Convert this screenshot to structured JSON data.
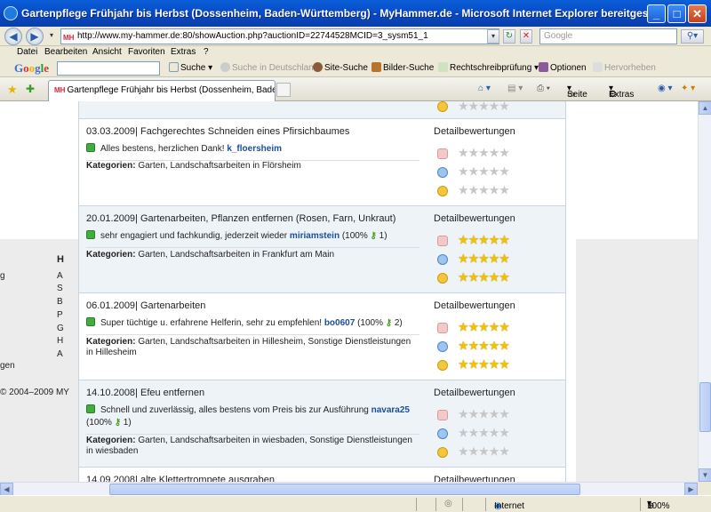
{
  "window": {
    "title": "Gartenpflege Frühjahr bis Herbst (Dossenheim, Baden-Württemberg) - MyHammer.de - Microsoft Internet Explorer bereitgestellt von",
    "buttons": {
      "minimize": "_",
      "maximize": "□",
      "close": "✕"
    }
  },
  "address": {
    "url": "http://www.my-hammer.de:80/showAuction.php?auctionID=22744528MCID=3_sysm51_1",
    "favicon_text": "MH",
    "search_placeholder": "Google"
  },
  "menu": [
    "Datei",
    "Bearbeiten",
    "Ansicht",
    "Favoriten",
    "Extras",
    "?"
  ],
  "google_toolbar": {
    "logo": "Google",
    "search_label": "Suche",
    "search_de_label": "Suche in Deutschland",
    "site_search_label": "Site-Suche",
    "image_search_label": "Bilder-Suche",
    "spellcheck_label": "Rechtschreibprüfung",
    "options_label": "Optionen",
    "highlight_label": "Hervorheben"
  },
  "tabs": {
    "active_title": "Gartenpflege Frühjahr bis Herbst (Dossenheim, Baden...",
    "favicon_text": "MH",
    "page_label": "Seite",
    "tools_label": "Extras"
  },
  "page": {
    "footer_heading": "H",
    "footer_letters": [
      "A",
      "S",
      "B",
      "P",
      "G",
      "H",
      "A"
    ],
    "footer_left_frags": [
      "g",
      "gen"
    ],
    "copyright": "© 2004–2009 MY"
  },
  "reviews": {
    "detail_label": "Detailbewertungen",
    "category_label": "Kategorien:",
    "items": [
      {
        "date": "03.03.2009",
        "task": "Fachgerechtes Schneiden eines Pfirsichbaumes",
        "comment": "Alles bestens, herzlichen Dank!",
        "user": "k_floersheim",
        "score_text": "",
        "score_count": "",
        "categories": "Garten, Landschaftsarbeiten in Flörsheim",
        "ratings": [
          0,
          0,
          0
        ]
      },
      {
        "date": "20.01.2009",
        "task": "Gartenarbeiten, Pflanzen entfernen (Rosen, Farn, Unkraut)",
        "comment": "sehr engagiert und fachkundig, jederzeit wieder",
        "user": "miriamstein",
        "score_text": "(100%",
        "score_count": "1)",
        "categories": "Garten, Landschaftsarbeiten in Frankfurt am Main",
        "ratings": [
          5,
          5,
          5
        ]
      },
      {
        "date": "06.01.2009",
        "task": "Gartenarbeiten",
        "comment": "Super tüchtige u. erfahrene Helferin, sehr zu empfehlen!",
        "user": "bo0607",
        "score_text": "(100%",
        "score_count": "2)",
        "categories": "Garten, Landschaftsarbeiten in Hillesheim, Sonstige Dienstleistungen in Hillesheim",
        "ratings": [
          5,
          5,
          5
        ]
      },
      {
        "date": "14.10.2008",
        "task": "Efeu entfernen",
        "comment": "Schnell und zuverlässig, alles bestens vom Preis bis zur Ausführung",
        "user": "navara25",
        "score_text": "(100%",
        "score_count": "1)",
        "categories": "Garten, Landschaftsarbeiten in wiesbaden, Sonstige Dienstleistungen in wiesbaden",
        "ratings": [
          0,
          0,
          0
        ]
      },
      {
        "date": "14.09.2008",
        "task": "alte Klettertrompete ausgraben",
        "comment": "",
        "user": "",
        "score_text": "",
        "score_count": "",
        "categories": "",
        "ratings": []
      }
    ]
  },
  "status": {
    "zone": "Internet",
    "zoom": "100%"
  },
  "colors": {
    "title_bar": "#0846c0",
    "link": "#1a4f9c",
    "star_on": "#f2c200",
    "star_off": "#c6c6c6",
    "row_alt": "#eef3f8"
  }
}
